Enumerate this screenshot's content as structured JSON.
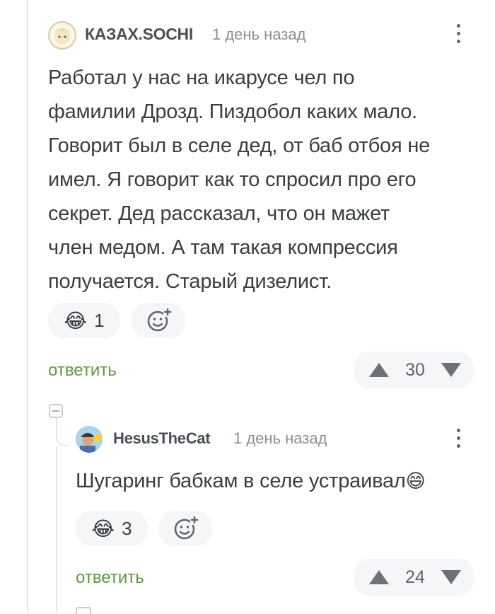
{
  "comment": {
    "username": "КАЗАХ.SOCHI",
    "time": "1 день назад",
    "text_lines": [
      "Работал у нас на икарусе чел по",
      "фамилии Дрозд. Пиздобол каких мало.",
      "Говорит был в селе дед, от баб отбоя не",
      "имел. Я говорит как то спросил про его",
      "секрет. Дед рассказал, что он мажет",
      "член медом. А там такая компрессия",
      "получается. Старый дизелист."
    ],
    "reaction": {
      "emoji": "😂",
      "count": "1"
    },
    "reply_label": "ответить",
    "rating": "30"
  },
  "reply": {
    "username": "HesusTheCat",
    "time": "1 день назад",
    "text": "Шугаринг бабкам в селе устраивал",
    "text_emoji": "😄",
    "reaction": {
      "emoji": "😂",
      "count": "3"
    },
    "reply_label": "ответить",
    "rating": "24"
  },
  "colors": {
    "accent_green": "#5b9c3a",
    "pill_bg": "#f4f6f8",
    "text": "#3a3e42",
    "muted": "#8a9096"
  },
  "icons": [
    "avatar",
    "more-vertical-icon",
    "add-reaction-icon",
    "upvote-icon",
    "downvote-icon",
    "collapse-icon"
  ]
}
